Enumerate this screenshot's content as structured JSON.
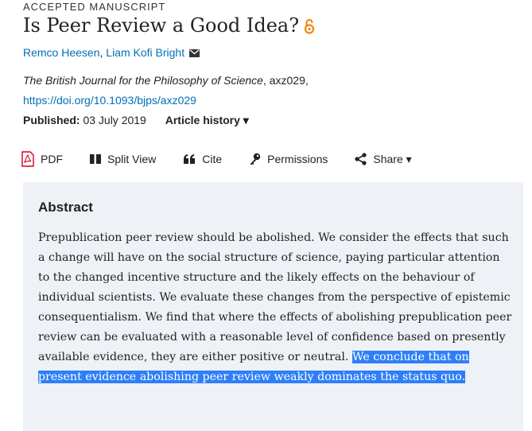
{
  "article": {
    "eyebrow": "ACCEPTED MANUSCRIPT",
    "title": "Is Peer Review a Good Idea?",
    "authors": [
      "Remco Heesen",
      "Liam Kofi Bright"
    ],
    "journal_name": "The British Journal for the Philosophy of Science",
    "journal_id": ", axz029,",
    "doi": "https://doi.org/10.1093/bjps/axz029",
    "published_label": "Published:",
    "published_date": "03 July 2019",
    "history_label": "Article history ▾"
  },
  "toolbar": {
    "pdf": "PDF",
    "split_view": "Split View",
    "cite": "Cite",
    "permissions": "Permissions",
    "share": "Share ▾"
  },
  "abstract": {
    "heading": "Abstract",
    "text_plain": "Prepublication peer review should be abolished. We consider the effects that such a change will have on the social structure of science, paying particular attention to the changed incentive structure and the likely effects on the behaviour of individual scientists. We evaluate these changes from the perspective of epistemic consequentialism. We find that where the effects of abolishing prepublication peer review can be evaluated with a reasonable level of confidence based on presently available evidence, they are either positive or neutral.",
    "text_selected": "We conclude that on present evidence abolishing peer review weakly dominates the status quo."
  },
  "colors": {
    "link": "#006fb7",
    "open_access": "#f68212",
    "pdf_red": "#d0021b",
    "abstract_bg": "#eef1f6",
    "selection": "#2d7ff9"
  },
  "icons": [
    "open-access-lock-icon",
    "envelope-icon",
    "pdf-icon",
    "split-view-icon",
    "quote-icon",
    "key-icon",
    "share-icon"
  ]
}
